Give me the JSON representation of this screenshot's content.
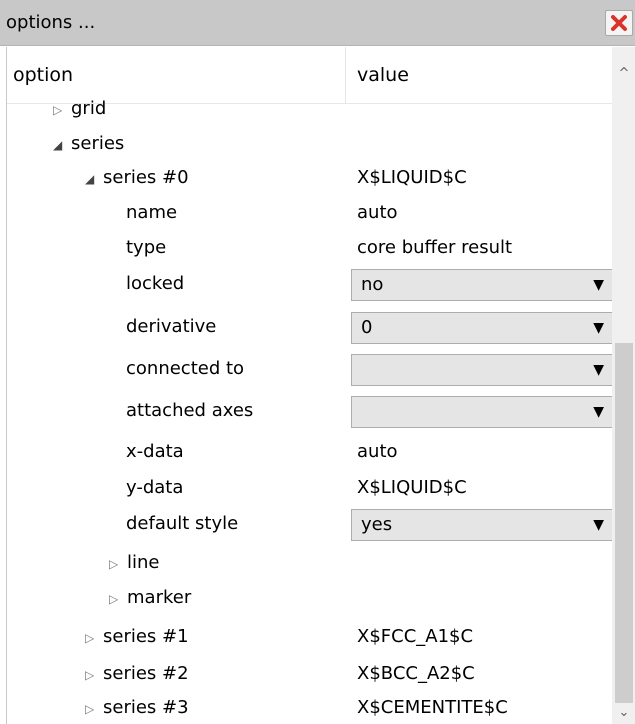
{
  "window": {
    "title": "options ...",
    "close_icon": "close-x-icon",
    "close_color": "#d9342b"
  },
  "table": {
    "col_option": "option",
    "col_value": "value"
  },
  "rows": [
    {
      "id": "grid",
      "label": "grid",
      "level": 1,
      "toggle": "collapsed",
      "value": "",
      "kind": "text"
    },
    {
      "id": "series",
      "label": "series",
      "level": 1,
      "toggle": "expanded",
      "value": "",
      "kind": "text"
    },
    {
      "id": "series-0",
      "label": "series #0",
      "level": 2,
      "toggle": "expanded",
      "value": "X$LIQUID$C",
      "kind": "text"
    },
    {
      "id": "name",
      "label": "name",
      "level": 3,
      "toggle": "none",
      "value": "auto",
      "kind": "text"
    },
    {
      "id": "type",
      "label": "type",
      "level": 3,
      "toggle": "none",
      "value": "core buffer result",
      "kind": "text"
    },
    {
      "id": "locked",
      "label": "locked",
      "level": 3,
      "toggle": "none",
      "value": "no",
      "kind": "combo"
    },
    {
      "id": "derivative",
      "label": "derivative",
      "level": 3,
      "toggle": "none",
      "value": "0",
      "kind": "combo"
    },
    {
      "id": "connected-to",
      "label": "connected to",
      "level": 3,
      "toggle": "none",
      "value": "",
      "kind": "combo"
    },
    {
      "id": "attached-axes",
      "label": "attached axes",
      "level": 3,
      "toggle": "none",
      "value": "",
      "kind": "combo"
    },
    {
      "id": "x-data",
      "label": "x-data",
      "level": 3,
      "toggle": "none",
      "value": "auto",
      "kind": "text"
    },
    {
      "id": "y-data",
      "label": "y-data",
      "level": 3,
      "toggle": "none",
      "value": "X$LIQUID$C",
      "kind": "text"
    },
    {
      "id": "default-style",
      "label": "default style",
      "level": 3,
      "toggle": "none",
      "value": "yes",
      "kind": "combo"
    },
    {
      "id": "line",
      "label": "line",
      "level": 3,
      "toggle": "collapsed",
      "value": "",
      "kind": "text"
    },
    {
      "id": "marker",
      "label": "marker",
      "level": 3,
      "toggle": "collapsed",
      "value": "",
      "kind": "text"
    },
    {
      "id": "series-1",
      "label": "series #1",
      "level": 2,
      "toggle": "collapsed",
      "value": "X$FCC_A1$C",
      "kind": "text"
    },
    {
      "id": "series-2",
      "label": "series #2",
      "level": 2,
      "toggle": "collapsed",
      "value": "X$BCC_A2$C",
      "kind": "text"
    },
    {
      "id": "series-3",
      "label": "series #3",
      "level": 2,
      "toggle": "collapsed",
      "value": "X$CEMENTITE$C",
      "kind": "text"
    }
  ],
  "scrollbar": {
    "up_icon": "scroll-up-arrow-icon",
    "down_icon": "scroll-down-arrow-icon",
    "position": 0.6
  }
}
